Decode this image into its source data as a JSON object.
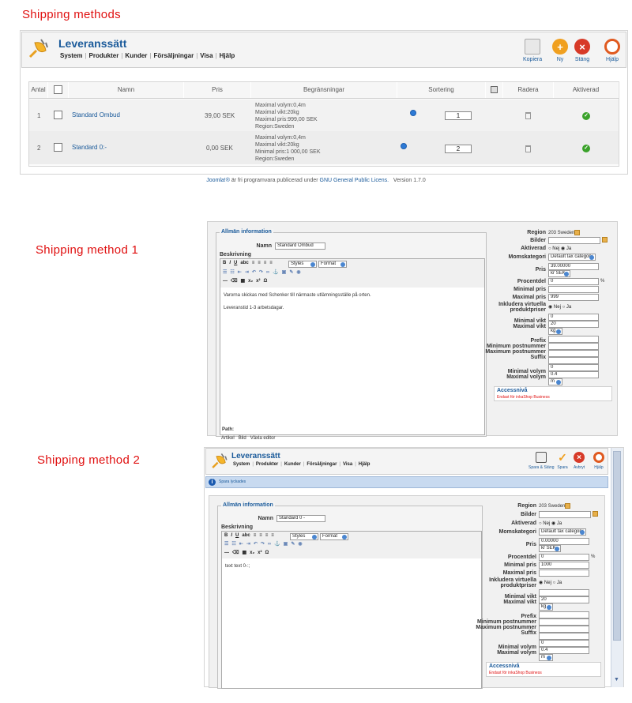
{
  "captions": {
    "panel1": "Shipping methods",
    "panel2": "Shipping method 1",
    "panel3": "Shipping method 2"
  },
  "app": {
    "title": "Leveranssätt",
    "menu": [
      "System",
      "Produkter",
      "Kunder",
      "Försäljningar",
      "Visa",
      "Hjälp"
    ]
  },
  "toolbar_list": {
    "kopiera": "Kopiera",
    "ny": "Ny",
    "stang": "Stäng",
    "hjalp": "Hjälp"
  },
  "toolbar_edit": {
    "spara_stang": "Spara & Stäng",
    "spara": "Spara",
    "avbryt": "Avbryt",
    "hjalp": "Hjälp"
  },
  "table": {
    "headers": {
      "antal": "Antal",
      "namn": "Namn",
      "pris": "Pris",
      "begransningar": "Begränsningar",
      "sortering": "Sortering",
      "radera": "Radera",
      "aktiverad": "Aktiverad"
    },
    "rows": [
      {
        "num": "1",
        "name": "Standard Ombud",
        "price": "39,00 SEK",
        "restrictions": [
          "Maximal volym:0,4m",
          "Maximal vikt:20kg",
          "Maximal pris:999,00 SEK",
          "Region:Sweden"
        ],
        "order": "1"
      },
      {
        "num": "2",
        "name": "Standard 0:-",
        "price": "0,00 SEK",
        "restrictions": [
          "Maximal volym:0,4m",
          "Maximal vikt:20kg",
          "Minimal pris:1 000,00 SEK",
          "Region:Sweden"
        ],
        "order": "2"
      }
    ]
  },
  "footer": {
    "joomla": "Joomla!®",
    "text": " är fri programvara publicerad under ",
    "license": "GNU General Public Licens.",
    "version": "Version 1.7.0"
  },
  "form_labels": {
    "allman": "Allmän information",
    "namn": "Namn",
    "beskrivning": "Beskrivning",
    "region": "Region",
    "bilder": "Bilder",
    "aktiverad": "Aktiverad",
    "momskategori": "Momskategori",
    "pris": "Pris",
    "procentdel": "Procentdel",
    "minimal_pris": "Minimal pris",
    "maximal_pris": "Maximal pris",
    "inkludera1": "Inkludera virtuella",
    "inkludera2": "produktpriser",
    "minimal_vikt": "Minimal vikt",
    "maximal_vikt": "Maximal vikt",
    "prefix": "Prefix",
    "min_post": "Minimum postnummer",
    "max_post": "Maximum postnummer",
    "suffix": "Suffix",
    "minimal_volym": "Minimal volym",
    "maximal_volym": "Maximal volym",
    "accessniva": "Accessnivå",
    "accessniva_sub": "Endast för inkaShop Business",
    "nej": "Nej",
    "ja": "Ja",
    "styles": "Styles",
    "format": "Format",
    "path": "Path:",
    "pct": "%",
    "tab_artikel": "Artikel",
    "tab_bild": "Bild",
    "tab_vaxla": "Växla editor"
  },
  "form1": {
    "name": "Standard Ombud",
    "region": "203 Sweden",
    "momskategori": "Default tax category",
    "price": "39.00000",
    "currency": "kr SEK",
    "procentdel": "0",
    "minimal_pris": "",
    "maximal_pris": "999",
    "minimal_vikt": "0",
    "maximal_vikt": "20",
    "vikt_unit": "kg",
    "minimal_volym": "0",
    "maximal_volym": "0.4",
    "volym_unit": "m",
    "desc_line1": "Varorna skickas med Schenker till närmaste utlämningsställe på orten.",
    "desc_line2": "Leveranstid 1-3 arbetsdagar."
  },
  "form2": {
    "name": "Standard 0 -",
    "region": "203 Sweden",
    "momskategori": "Default tax category",
    "price": "0.00000",
    "currency": "kr SEK",
    "procentdel": "0",
    "minimal_pris": "1000",
    "maximal_pris": "",
    "minimal_vikt": "",
    "maximal_vikt": "20",
    "vikt_unit": "kg",
    "minimal_volym": "0",
    "maximal_volym": "0.4",
    "volym_unit": "m",
    "desc_line1": "text text 0-:;",
    "notice": "Spara lyckades"
  }
}
